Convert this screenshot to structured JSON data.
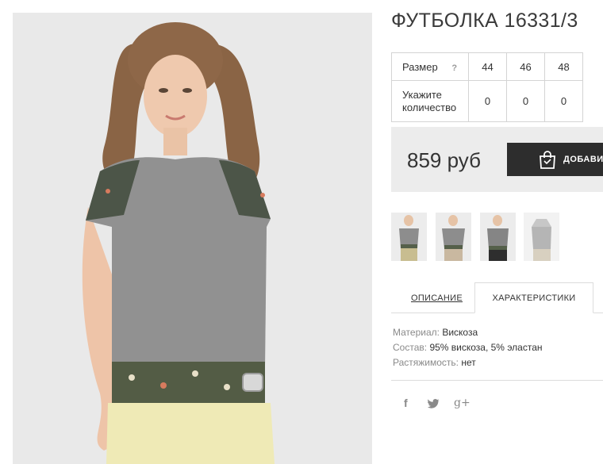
{
  "product": {
    "title": "ФУТБОЛКА 16331/3",
    "image_alt": "Model in grey t-shirt with floral trim"
  },
  "sizes_table": {
    "size_label": "Размер",
    "help_icon": "?",
    "sizes": [
      "44",
      "46",
      "48"
    ],
    "quantity_label": "Укажите количество",
    "quantities": [
      "0",
      "0",
      "0"
    ]
  },
  "price": {
    "value": "859 руб",
    "button_label": "ДОБАВИТЬ",
    "button_icon": "shopping-bag-icon"
  },
  "thumbnails": [
    "thumbnail-1",
    "thumbnail-2",
    "thumbnail-3",
    "thumbnail-4"
  ],
  "tabs": {
    "description": "ОПИСАНИЕ",
    "characteristics": "ХАРАКТЕРИСТИКИ",
    "active": "characteristics"
  },
  "specs": [
    {
      "key": "Материал:",
      "value": "Вискоза"
    },
    {
      "key": "Состав:",
      "value": "95% вискоза, 5% эластан"
    },
    {
      "key": "Растяжимость:",
      "value": "нет"
    }
  ],
  "social": {
    "facebook": "f",
    "twitter": "twitter-icon",
    "googleplus": "g+"
  },
  "colors": {
    "button_bg": "#2d2d2d",
    "price_bar_bg": "#ececec",
    "photo_bg": "#e8e8e8"
  }
}
